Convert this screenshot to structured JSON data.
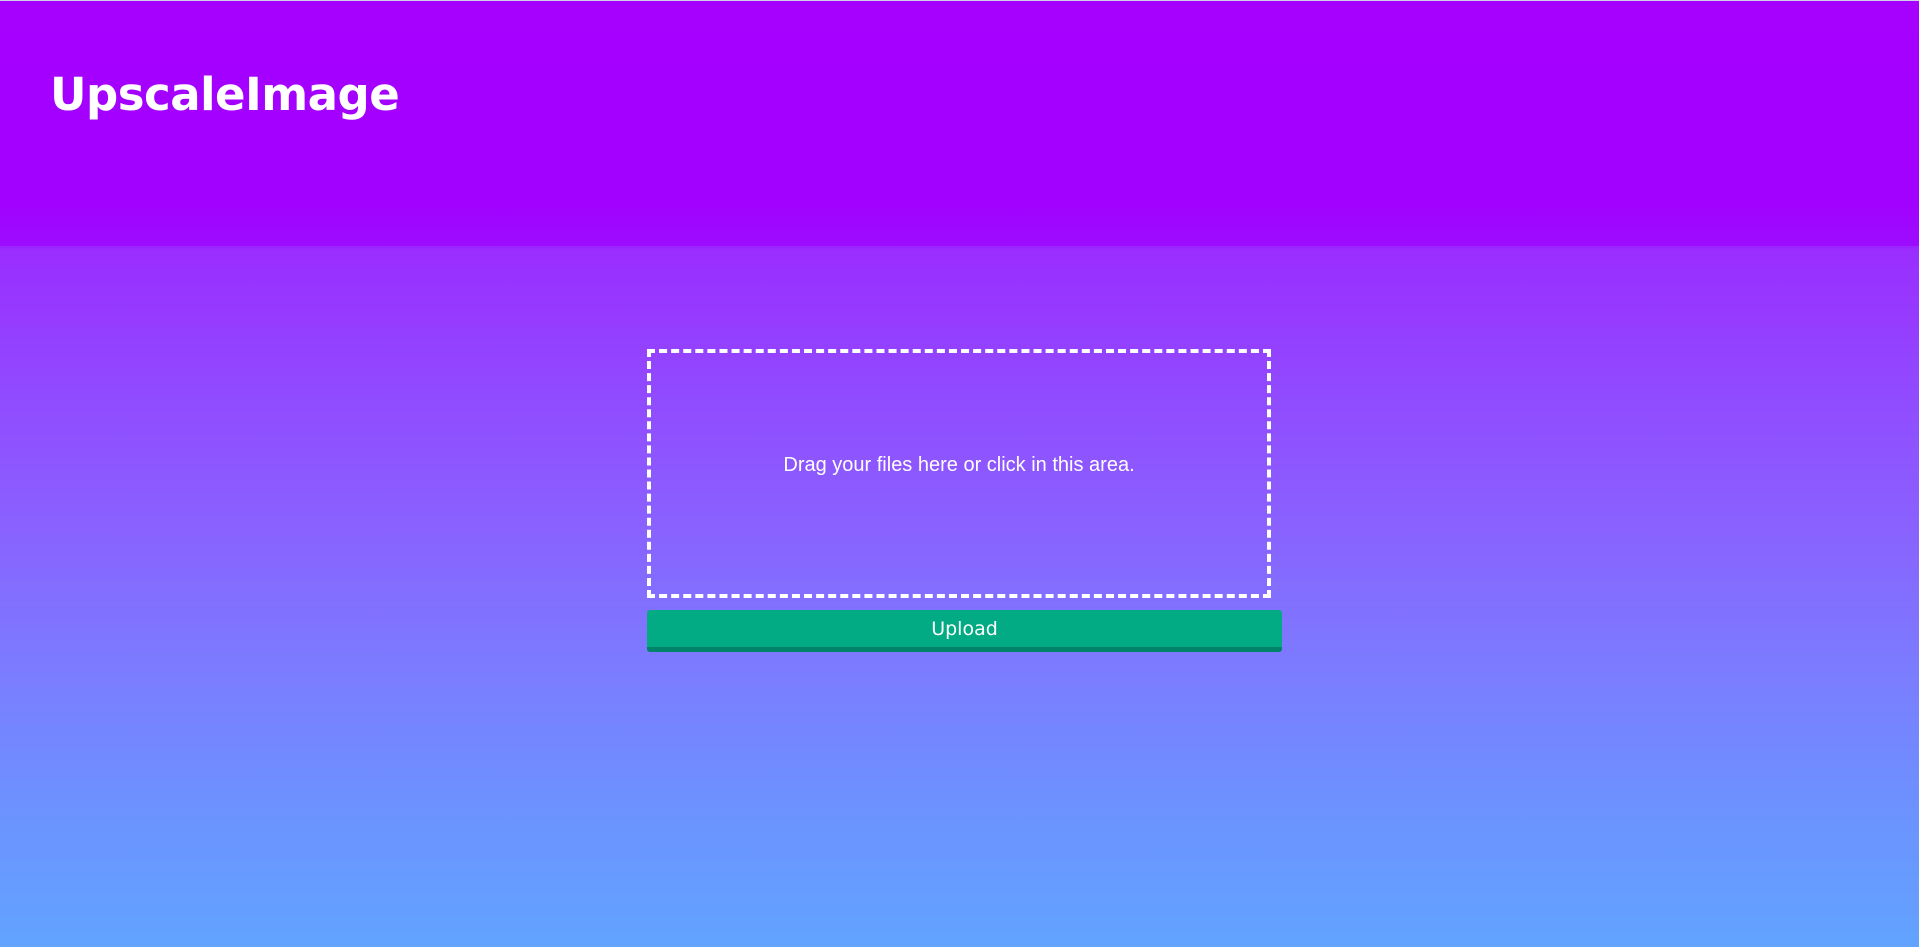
{
  "header": {
    "logo_text": "UpscaleImage"
  },
  "upload": {
    "dropzone_text": "Drag your files here or click in this area.",
    "button_label": "Upload"
  },
  "colors": {
    "header_purple": "#a600ff",
    "gradient_bottom": "#62a3ff",
    "button_green": "#02ab84",
    "button_shadow": "#01826a",
    "text": "#ffffff"
  }
}
